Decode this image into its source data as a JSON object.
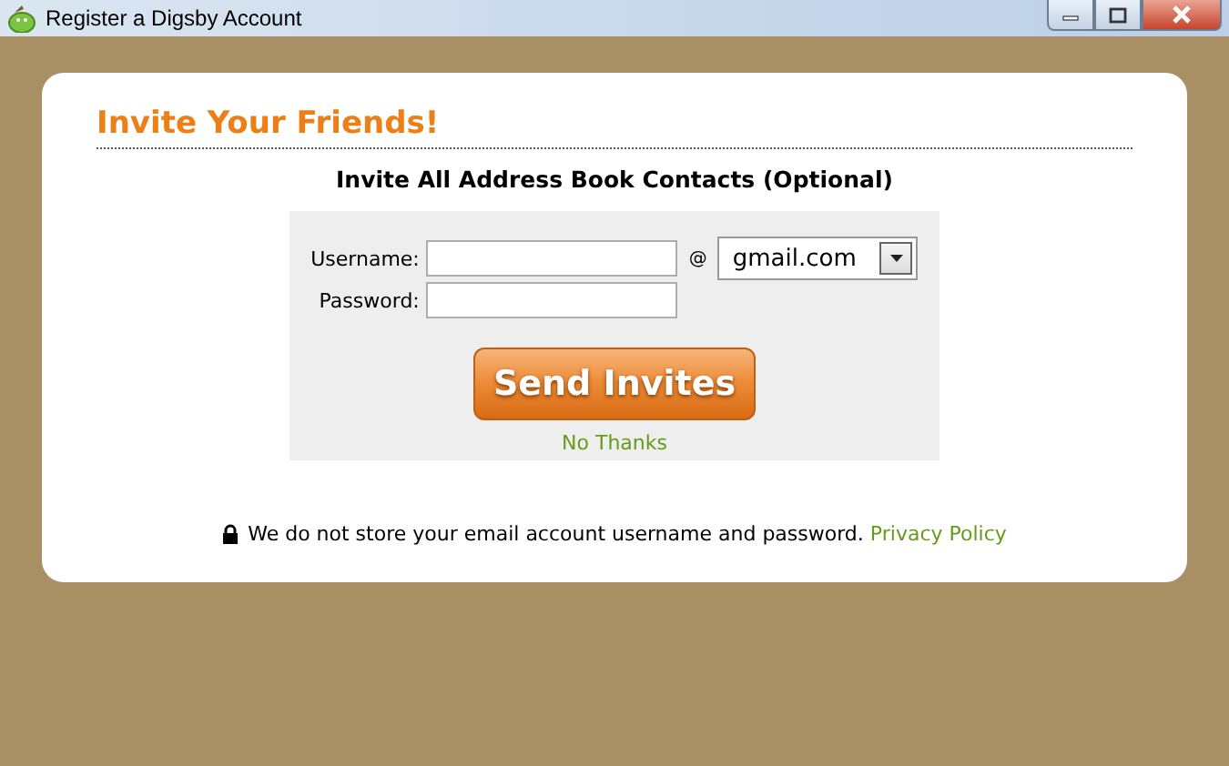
{
  "window": {
    "title": "Register a Digsby Account"
  },
  "heading": "Invite Your Friends!",
  "subheading": "Invite All Address Book Contacts (Optional)",
  "form": {
    "username_label": "Username:",
    "at": "@",
    "domain": "gmail.com",
    "password_label": "Password:"
  },
  "send_button": "Send Invites",
  "no_thanks": "No Thanks",
  "note": "We do not store your email account username and password.",
  "privacy_link": "Privacy Policy"
}
